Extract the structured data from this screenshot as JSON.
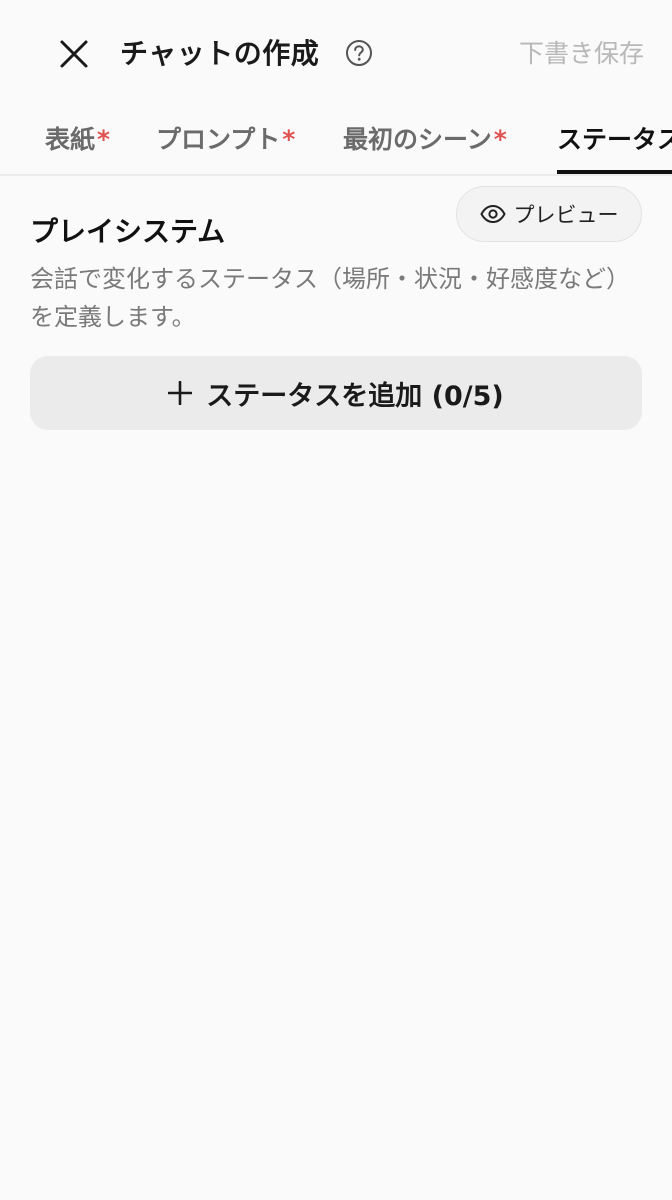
{
  "header": {
    "title": "チャットの作成",
    "draft_label": "下書き保存"
  },
  "tabs": [
    {
      "label": "表紙",
      "required": "*"
    },
    {
      "label": "プロンプト",
      "required": "*"
    },
    {
      "label": "最初のシーン",
      "required": "*"
    },
    {
      "label": "ステータス",
      "required": ""
    }
  ],
  "section": {
    "title": "プレイシステム",
    "description": "会話で変化するステータス（場所・状況・好感度など）を定義します。",
    "preview_label": "プレビュー",
    "add_label": "ステータスを追加 (0/5)"
  },
  "icons": {
    "close": "close-icon",
    "help": "help-icon",
    "eye": "eye-icon",
    "plus": "plus-icon"
  },
  "colors": {
    "required_mark": "#e05252",
    "active_tab": "#111111",
    "inactive_tab": "#6b6b6b",
    "muted_text": "#7a7a7a",
    "disabled_text": "#b8b8b8",
    "background": "#fafafa"
  }
}
